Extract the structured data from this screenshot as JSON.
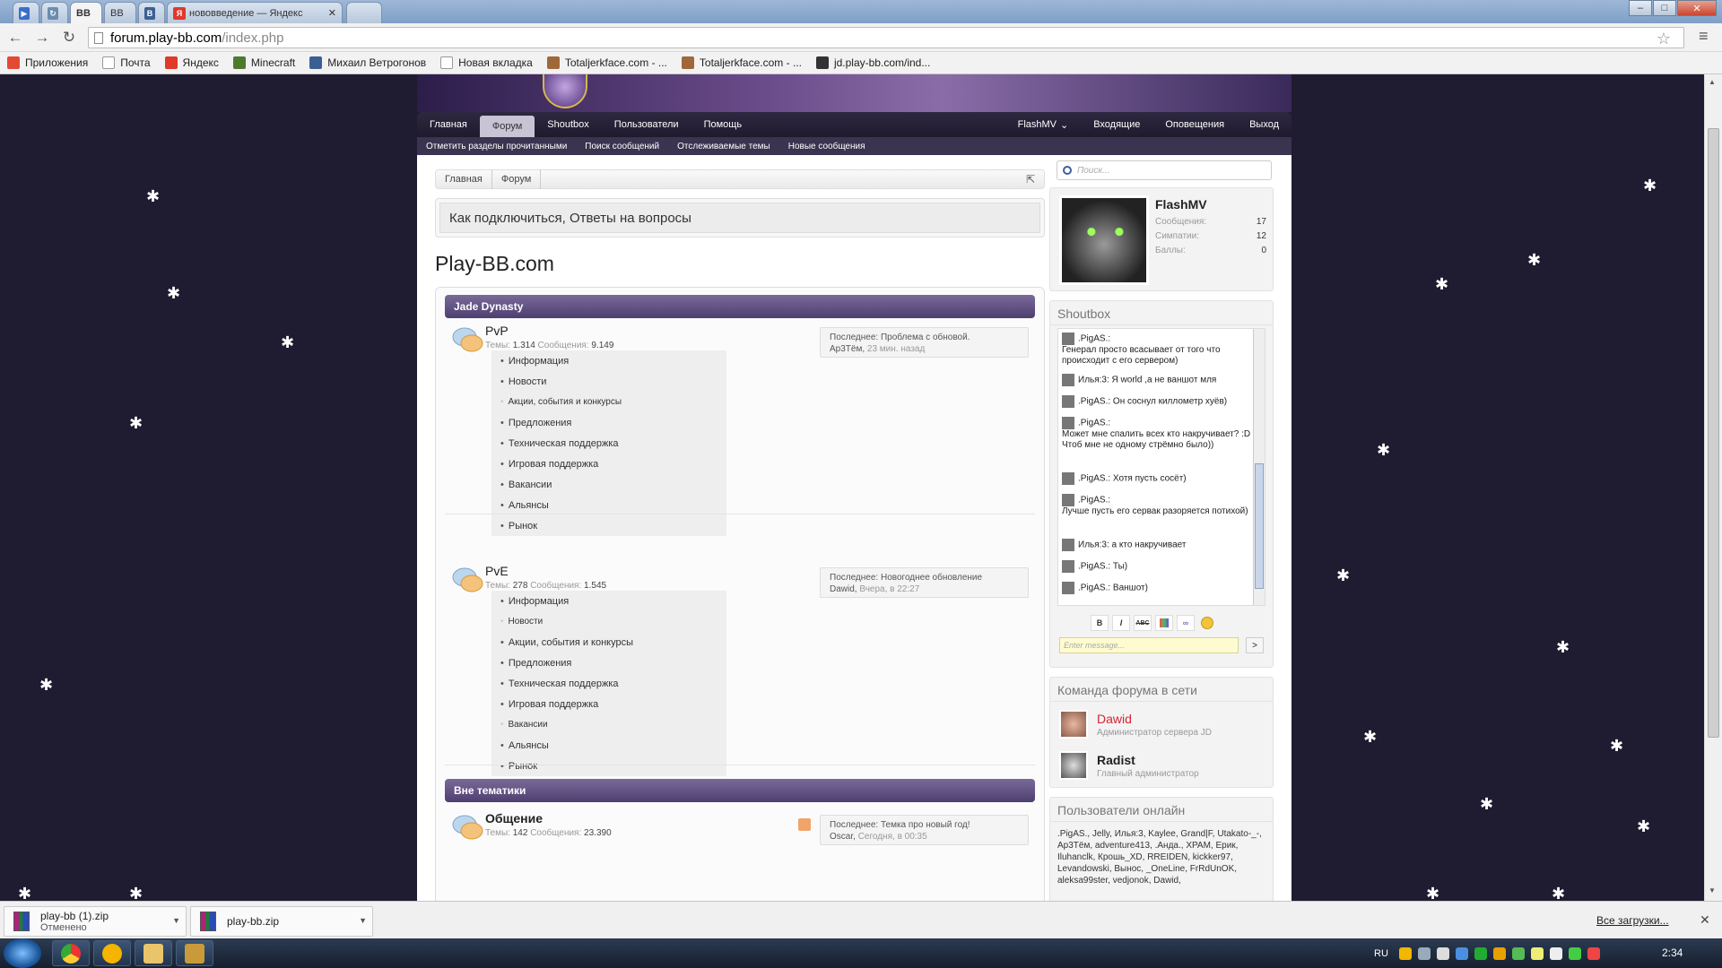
{
  "browser": {
    "tabs": [
      {
        "label": "",
        "icon": "play-icon"
      },
      {
        "label": "",
        "icon": "refresh-icon"
      },
      {
        "label": "BB",
        "icon": "bb-icon"
      },
      {
        "label": "BB",
        "icon": "bb-icon"
      },
      {
        "label": "В",
        "icon": "vk-icon"
      },
      {
        "label": "нововведение — Яндекс",
        "icon": "yandex-icon"
      }
    ],
    "address": {
      "host": "forum.play-bb.com",
      "path": "/index.php"
    },
    "bookmarks": [
      {
        "label": "Приложения",
        "icon": "apps-icon",
        "color": "#e24a33"
      },
      {
        "label": "Почта",
        "icon": "page-icon",
        "color": "#dddddd"
      },
      {
        "label": "Яндекс",
        "icon": "yandex-icon",
        "color": "#e0382a"
      },
      {
        "label": "Minecraft",
        "icon": "minecraft-icon",
        "color": "#4e7a2f"
      },
      {
        "label": "Михаил Ветрогонов",
        "icon": "vk-icon",
        "color": "#3b5f92"
      },
      {
        "label": "Новая вкладка",
        "icon": "page-icon",
        "color": "#dddddd"
      },
      {
        "label": "Totaljerkface.com - ...",
        "icon": "tjf-icon",
        "color": "#a0683a"
      },
      {
        "label": "Totaljerkface.com - ...",
        "icon": "tjf-icon",
        "color": "#a0683a"
      },
      {
        "label": "jd.play-bb.com/ind...",
        "icon": "bb-icon",
        "color": "#333333"
      }
    ]
  },
  "forum": {
    "nav": {
      "left": [
        "Главная",
        "Форум",
        "Shoutbox",
        "Пользователи",
        "Помощь"
      ],
      "right": [
        "FlashMV",
        "Входящие",
        "Оповещения",
        "Выход"
      ]
    },
    "subnav": [
      "Отметить разделы прочитанными",
      "Поиск сообщений",
      "Отслеживаемые темы",
      "Новые сообщения"
    ],
    "breadcrumb": [
      "Главная",
      "Форум"
    ],
    "notice": "Как подключиться, Ответы на вопросы",
    "site_title": "Play-BB.com",
    "categories": [
      {
        "title": "Jade Dynasty",
        "forums": [
          {
            "name": "PvP",
            "topics_label": "Темы:",
            "topics": "1.314",
            "posts_label": "Сообщения:",
            "posts": "9.149",
            "subforums": [
              "Информация",
              "Новости",
              "Акции, события и конкурсы",
              "Предложения",
              "Техническая поддержка",
              "Игровая поддержка",
              "Вакансии",
              "Альянсы",
              "Рынок"
            ],
            "last_label": "Последнее:",
            "last_title": "Проблема с обновой.",
            "last_user": "Ар3Тём,",
            "last_time": "23 мин. назад"
          },
          {
            "name": "PvE",
            "topics_label": "Темы:",
            "topics": "278",
            "posts_label": "Сообщения:",
            "posts": "1.545",
            "subforums": [
              "Информация",
              "Новости",
              "Акции, события и конкурсы",
              "Предложения",
              "Техническая поддержка",
              "Игровая поддержка",
              "Вакансии",
              "Альянсы",
              "Рынок"
            ],
            "last_label": "Последнее:",
            "last_title": "Новогоднее обновление",
            "last_user": "Dawid,",
            "last_time": "Вчера, в 22:27"
          }
        ]
      },
      {
        "title": "Вне тематики",
        "forums": [
          {
            "name": "Общение",
            "topics_label": "Темы:",
            "topics": "142",
            "posts_label": "Сообщения:",
            "posts": "23.390",
            "last_label": "Последнее:",
            "last_title": "Темка про новый год!",
            "last_user": "Oscar,",
            "last_time": "Сегодня, в 00:35"
          }
        ]
      }
    ]
  },
  "sidebar": {
    "search_placeholder": "Поиск...",
    "visitor": {
      "name": "FlashMV",
      "stats": [
        {
          "label": "Сообщения:",
          "value": "17"
        },
        {
          "label": "Симпатии:",
          "value": "12"
        },
        {
          "label": "Баллы:",
          "value": "0"
        }
      ]
    },
    "shoutbox": {
      "title": "Shoutbox",
      "messages": [
        {
          "user": ".PigAS.:",
          "text": "Генерал просто всасывает от того что происходит с его сервером)"
        },
        {
          "user": "Илья:3:",
          "text": "Я world ,а не ваншот мля"
        },
        {
          "user": ".PigAS.:",
          "text": "Он соснул киллометр хуёв)"
        },
        {
          "user": ".PigAS.:",
          "text": "Может мне спалить всех кто накручивает? :D Чтоб мне не одному стрёмно было))"
        },
        {
          "user": ".PigAS.:",
          "text": "Хотя пусть сосёт)"
        },
        {
          "user": ".PigAS.:",
          "text": "Лучше пусть его сервак разоряется потихой)"
        },
        {
          "user": "Илья:3:",
          "text": "а кто накручивает"
        },
        {
          "user": ".PigAS.:",
          "text": "Ты)"
        },
        {
          "user": ".PigAS.:",
          "text": "Ваншот)"
        }
      ],
      "tools": [
        "B",
        "I",
        "ABC",
        "",
        "",
        ""
      ],
      "input_placeholder": "Enter message...",
      "send": ">"
    },
    "staff": {
      "title": "Команда форума в сети",
      "members": [
        {
          "name": "Dawid",
          "role": "Администратор сервера JD",
          "color": "#d9232e"
        },
        {
          "name": "Radist",
          "role": "Главный администратор",
          "color": "#222222"
        }
      ]
    },
    "online": {
      "title": "Пользователи онлайн",
      "list": ".PigAS., Jelly, Илья:3, Kaylee, Grand|F, Utakato-_-, Ар3Тём, adventure413, .Анда., XPAM, Ерик, Iluhanclk, Крошь_XD, RREIDEN, kickker97, Levandowski, Вынос, _OneLine, FrRdUnOK, aleksa99ster, vedjonok, Dawid,"
    }
  },
  "downloads": {
    "items": [
      {
        "name": "play-bb (1).zip",
        "status": "Отменено"
      },
      {
        "name": "play-bb.zip",
        "status": ""
      }
    ],
    "all_label": "Все загрузки..."
  },
  "taskbar": {
    "lang": "RU",
    "time": "2:34"
  }
}
